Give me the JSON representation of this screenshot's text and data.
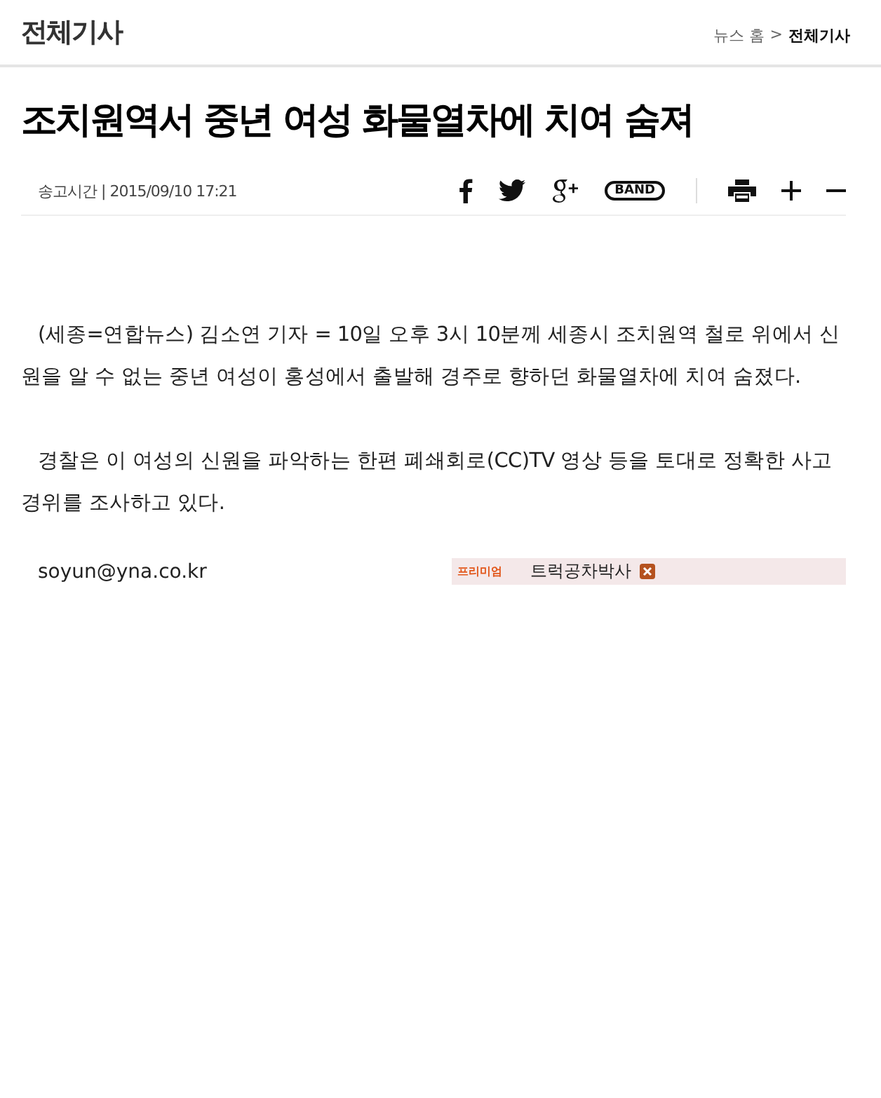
{
  "header": {
    "section_title": "전체기사",
    "breadcrumb": [
      {
        "label": "뉴스 홈",
        "selected": false
      },
      {
        "label": ">",
        "selected": false
      },
      {
        "label": "전체기사",
        "selected": true
      }
    ]
  },
  "article": {
    "headline": "조치원역서 중년 여성 화물열차에 치여 숨져",
    "sent_time": "송고시간 | 2015/09/10 17:21",
    "share_icons": [
      {
        "kind": "facebook"
      },
      {
        "kind": "twitter"
      },
      {
        "kind": "googleplus"
      },
      {
        "kind": "band",
        "label": "BAND"
      }
    ],
    "tools": [
      {
        "kind": "print"
      },
      {
        "kind": "plus"
      },
      {
        "kind": "minus"
      }
    ],
    "paragraphs": [
      "(세종=연합뉴스) 김소연 기자 = 10일 오후 3시 10분께 세종시 조치원역 철로 위에서 신원을 알 수 없는 중년 여성이 홍성에서 출발해 경주로 향하던 화물열차에 치여 숨졌다.",
      "경찰은 이 여성의 신원을 파악하는 한편 폐쇄회로(CC)TV 영상 등을 토대로 정확한 사고 경위를 조사하고 있다."
    ],
    "byline": "soyun@yna.co.kr",
    "ad": {
      "badge": "프리미엄",
      "text": "트럭공차박사"
    }
  }
}
